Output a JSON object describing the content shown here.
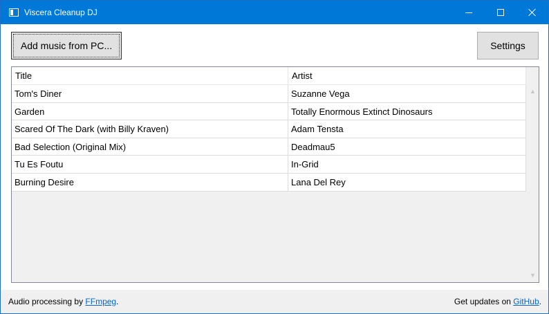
{
  "window": {
    "title": "Viscera Cleanup DJ",
    "icon": "app-window-icon"
  },
  "toolbar": {
    "add_music_label": "Add music from PC...",
    "settings_label": "Settings"
  },
  "list": {
    "columns": [
      "Title",
      "Artist"
    ],
    "rows": [
      {
        "title": "Tom's Diner",
        "artist": "Suzanne Vega"
      },
      {
        "title": "Garden",
        "artist": "Totally Enormous Extinct Dinosaurs"
      },
      {
        "title": "Scared Of The Dark (with Billy Kraven)",
        "artist": "Adam Tensta"
      },
      {
        "title": "Bad Selection (Original Mix)",
        "artist": "Deadmau5"
      },
      {
        "title": "Tu Es Foutu",
        "artist": "In-Grid"
      },
      {
        "title": "Burning Desire",
        "artist": "Lana Del Rey"
      }
    ]
  },
  "status": {
    "left_prefix": "Audio processing by ",
    "left_link": "FFmpeg",
    "left_suffix": ".",
    "right_prefix": "Get updates on ",
    "right_link": "GitHub",
    "right_suffix": "."
  },
  "colors": {
    "titlebar": "#0078d7",
    "link": "#0066cc"
  }
}
